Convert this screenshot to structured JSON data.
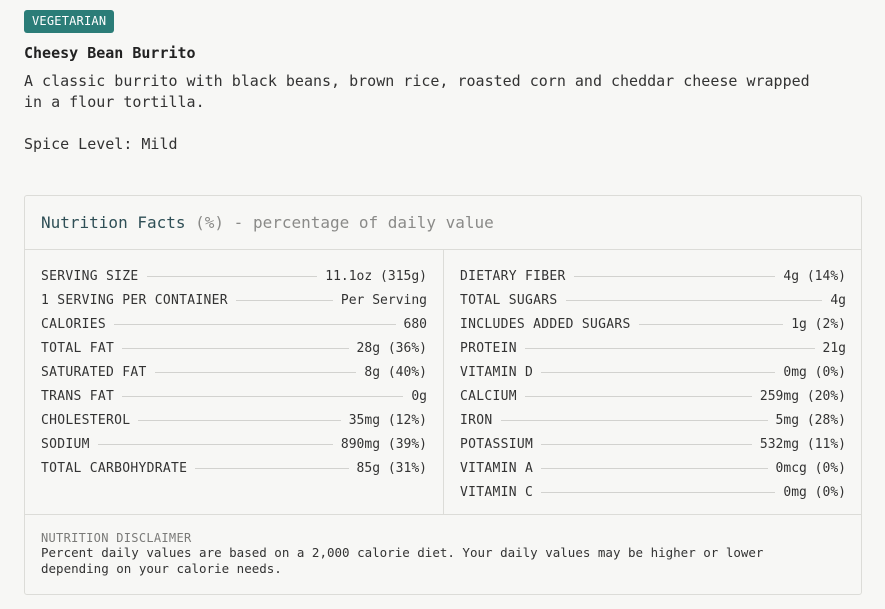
{
  "badge": "VEGETARIAN",
  "title": "Cheesy Bean Burrito",
  "description": "A classic burrito with black beans, brown rice, roasted corn and cheddar cheese wrapped in a flour tortilla.",
  "spice": "Spice Level: Mild",
  "nutrition": {
    "header_title": "Nutrition Facts",
    "header_sub": "(%) - percentage of daily value",
    "left": [
      {
        "label": "SERVING SIZE",
        "value": "11.1oz (315g)"
      },
      {
        "label": "1 SERVING PER CONTAINER",
        "value": "Per Serving"
      },
      {
        "label": "CALORIES",
        "value": "680"
      },
      {
        "label": "TOTAL FAT",
        "value": "28g (36%)"
      },
      {
        "label": "SATURATED FAT",
        "value": "8g (40%)"
      },
      {
        "label": "TRANS FAT",
        "value": "0g"
      },
      {
        "label": "CHOLESTEROL",
        "value": "35mg (12%)"
      },
      {
        "label": "SODIUM",
        "value": "890mg (39%)"
      },
      {
        "label": "TOTAL CARBOHYDRATE",
        "value": "85g (31%)"
      }
    ],
    "right": [
      {
        "label": "DIETARY FIBER",
        "value": "4g (14%)"
      },
      {
        "label": "TOTAL SUGARS",
        "value": "4g"
      },
      {
        "label": "INCLUDES ADDED SUGARS",
        "value": "1g (2%)"
      },
      {
        "label": "PROTEIN",
        "value": "21g"
      },
      {
        "label": "VITAMIN D",
        "value": "0mg (0%)"
      },
      {
        "label": "CALCIUM",
        "value": "259mg (20%)"
      },
      {
        "label": "IRON",
        "value": "5mg (28%)"
      },
      {
        "label": "POTASSIUM",
        "value": "532mg (11%)"
      },
      {
        "label": "VITAMIN A",
        "value": "0mcg (0%)"
      },
      {
        "label": "VITAMIN C",
        "value": "0mg (0%)"
      }
    ],
    "disclaimer_title": "NUTRITION DISCLAIMER",
    "disclaimer_text": "Percent daily values are based on a 2,000 calorie diet. Your daily values may be higher or lower depending on your calorie needs."
  },
  "colors": {
    "badge_bg": "#2b7d78",
    "header_text": "#2f4f56"
  }
}
